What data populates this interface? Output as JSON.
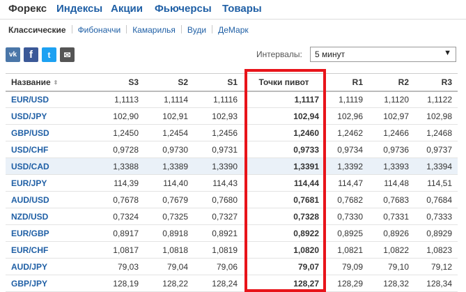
{
  "top_tabs": [
    "Форекс",
    "Индексы",
    "Акции",
    "Фьючерсы",
    "Товары"
  ],
  "top_tab_active": 0,
  "sub_tabs": [
    "Классические",
    "Фибоначчи",
    "Камарилья",
    "Вуди",
    "ДеМарк"
  ],
  "sub_tab_active": 0,
  "social": {
    "vk": "vk",
    "facebook": "f",
    "twitter": "t",
    "mail": "✉"
  },
  "intervals": {
    "label": "Интервалы:",
    "value": "5 минут",
    "arrow": "▼"
  },
  "table": {
    "headers": [
      "Название",
      "S3",
      "S2",
      "S1",
      "Точки пивот",
      "R1",
      "R2",
      "R3"
    ],
    "sort_icon": "⇕",
    "highlighted_row": 4,
    "rows": [
      [
        "EUR/USD",
        "1,1113",
        "1,1114",
        "1,1116",
        "1,1117",
        "1,1119",
        "1,1120",
        "1,1122"
      ],
      [
        "USD/JPY",
        "102,90",
        "102,91",
        "102,93",
        "102,94",
        "102,96",
        "102,97",
        "102,98"
      ],
      [
        "GBP/USD",
        "1,2450",
        "1,2454",
        "1,2456",
        "1,2460",
        "1,2462",
        "1,2466",
        "1,2468"
      ],
      [
        "USD/CHF",
        "0,9728",
        "0,9730",
        "0,9731",
        "0,9733",
        "0,9734",
        "0,9736",
        "0,9737"
      ],
      [
        "USD/CAD",
        "1,3388",
        "1,3389",
        "1,3390",
        "1,3391",
        "1,3392",
        "1,3393",
        "1,3394"
      ],
      [
        "EUR/JPY",
        "114,39",
        "114,40",
        "114,43",
        "114,44",
        "114,47",
        "114,48",
        "114,51"
      ],
      [
        "AUD/USD",
        "0,7678",
        "0,7679",
        "0,7680",
        "0,7681",
        "0,7682",
        "0,7683",
        "0,7684"
      ],
      [
        "NZD/USD",
        "0,7324",
        "0,7325",
        "0,7327",
        "0,7328",
        "0,7330",
        "0,7331",
        "0,7333"
      ],
      [
        "EUR/GBP",
        "0,8917",
        "0,8918",
        "0,8921",
        "0,8922",
        "0,8925",
        "0,8926",
        "0,8929"
      ],
      [
        "EUR/CHF",
        "1,0817",
        "1,0818",
        "1,0819",
        "1,0820",
        "1,0821",
        "1,0822",
        "1,0823"
      ],
      [
        "AUD/JPY",
        "79,03",
        "79,04",
        "79,06",
        "79,07",
        "79,09",
        "79,10",
        "79,12"
      ],
      [
        "GBP/JPY",
        "128,19",
        "128,22",
        "128,24",
        "128,27",
        "128,29",
        "128,32",
        "128,34"
      ]
    ]
  },
  "colors": {
    "link": "#1f5fa5",
    "highlight_frame": "#e8141a",
    "row_highlight": "#eaf1f8"
  }
}
